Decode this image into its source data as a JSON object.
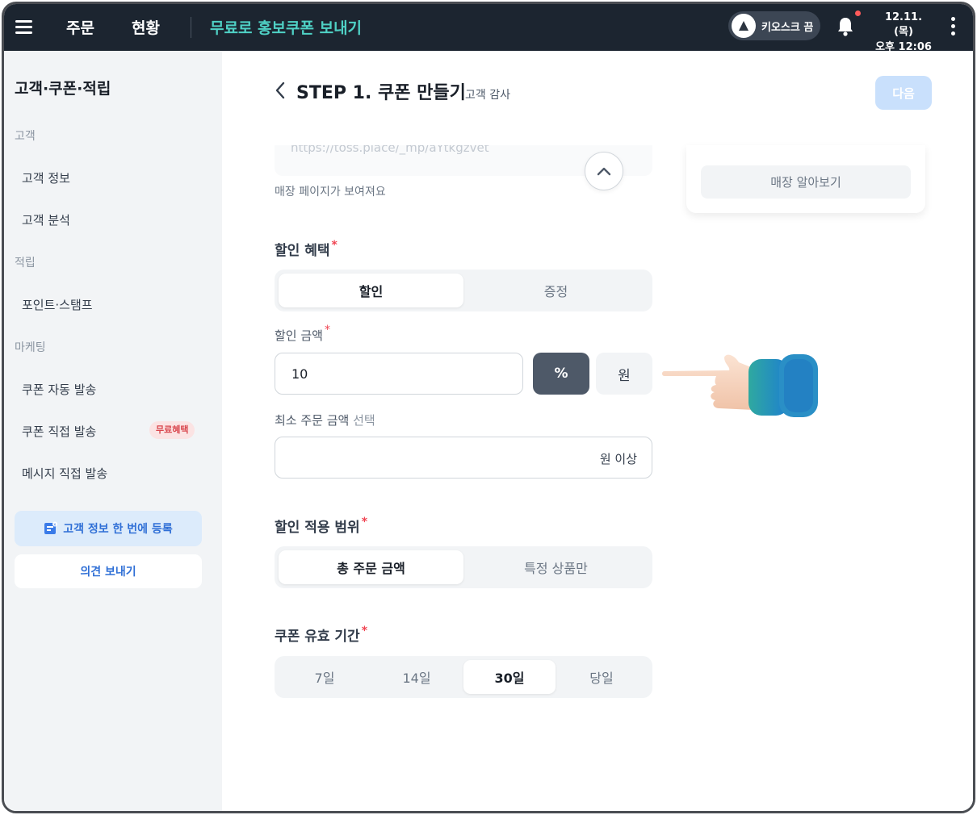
{
  "topbar": {
    "nav": [
      "주문",
      "현황"
    ],
    "active_title": "무료로 홍보쿠폰 보내기",
    "kiosk_label": "키오스크 끔",
    "date": "12.11. (목)",
    "time": "오후 12:06",
    "icons": [
      "menu-icon",
      "bell-icon",
      "kebab-menu-icon"
    ]
  },
  "sidebar": {
    "title": "고객·쿠폰·적립",
    "sections": [
      {
        "label": "고객",
        "items": [
          "고객 정보",
          "고객 분석"
        ]
      },
      {
        "label": "적립",
        "items": [
          "포인트·스탬프"
        ]
      },
      {
        "label": "마케팅",
        "items": [
          "쿠폰 자동 발송",
          "쿠폰 직접 발송",
          "메시지 직접 발송"
        ]
      }
    ],
    "badge": "무료혜택",
    "primary_button": "고객 정보 한 번에 등록",
    "secondary_button": "의견 보내기"
  },
  "main": {
    "step_title": "STEP 1. 쿠폰 만들기",
    "step_subtitle": "고객 감사",
    "next_button": "다음",
    "url_partial": "https://toss.place/_mp/aYtkgzvet",
    "url_helper": "매장 페이지가 보여져요",
    "store_button": "매장 알아보기",
    "benefit": {
      "label": "할인 혜택",
      "options": [
        "할인",
        "증정"
      ],
      "selected": "할인"
    },
    "discount_amount": {
      "label": "할인 금액",
      "value": "10",
      "units": [
        "%",
        "원"
      ],
      "selected_unit": "%"
    },
    "min_order": {
      "label": "최소 주문 금액",
      "optional": "선택",
      "value": "",
      "suffix": "원 이상"
    },
    "scope": {
      "label": "할인 적용 범위",
      "options": [
        "총 주문 금액",
        "특정 상품만"
      ],
      "selected": "총 주문 금액"
    },
    "validity": {
      "label": "쿠폰 유효 기간",
      "options": [
        "7일",
        "14일",
        "30일",
        "당일"
      ],
      "selected": "30일"
    },
    "required_mark": "*"
  },
  "colors": {
    "topbar_bg": "#1c2530",
    "accent_teal": "#4fd1c5",
    "primary_blue": "#2f6fd6",
    "selected_unit_bg": "#4e5968",
    "required_red": "#f04452"
  }
}
